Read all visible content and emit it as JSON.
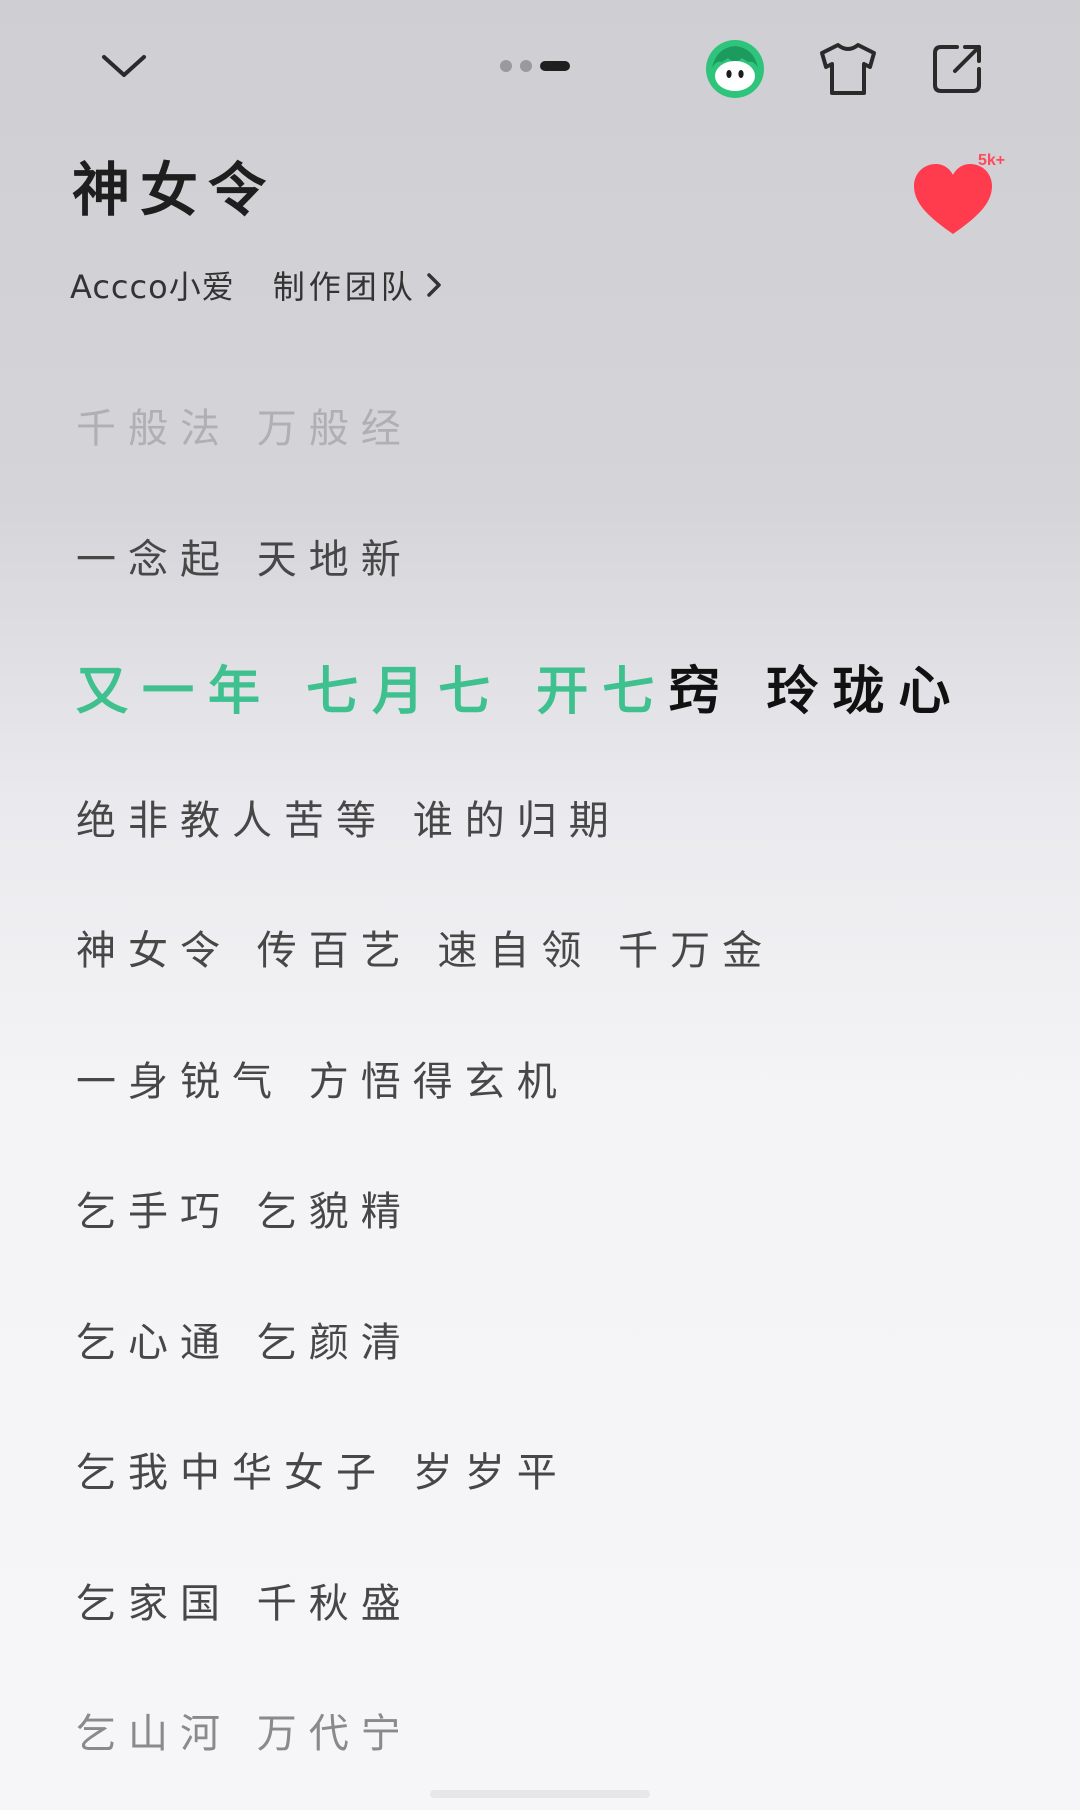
{
  "header": {
    "collapse_icon": "chevron-down-icon",
    "page_indicator": {
      "count": 3,
      "active_index": 2
    },
    "mascot_icon": "mascot-icon",
    "shirt_icon": "tshirt-icon",
    "share_icon": "share-icon"
  },
  "song": {
    "title": "神女令",
    "artist": "Accco小爱",
    "team_label": "制作团队",
    "like_count": "5k+",
    "like_icon": "heart-icon"
  },
  "lyrics": [
    "千般法 万般经",
    "一念起 天地新",
    "又一年 七月七 开七窍 玲珑心",
    "绝非教人苦等 谁的归期",
    "神女令 传百艺 速自领 千万金",
    "一身锐气 方悟得玄机",
    "乞手巧 乞貌精",
    "乞心通 乞颜清",
    "乞我中华女子 岁岁平",
    "乞家国 千秋盛",
    "乞山河 万代宁"
  ],
  "current_line": {
    "sung": "又一年 七月七 开七",
    "unsung": "窍 玲珑心",
    "progress": 0.64
  },
  "colors": {
    "highlight": "#3ec08f",
    "heart": "#ff3b4e",
    "mascot": "#2fc47c"
  }
}
